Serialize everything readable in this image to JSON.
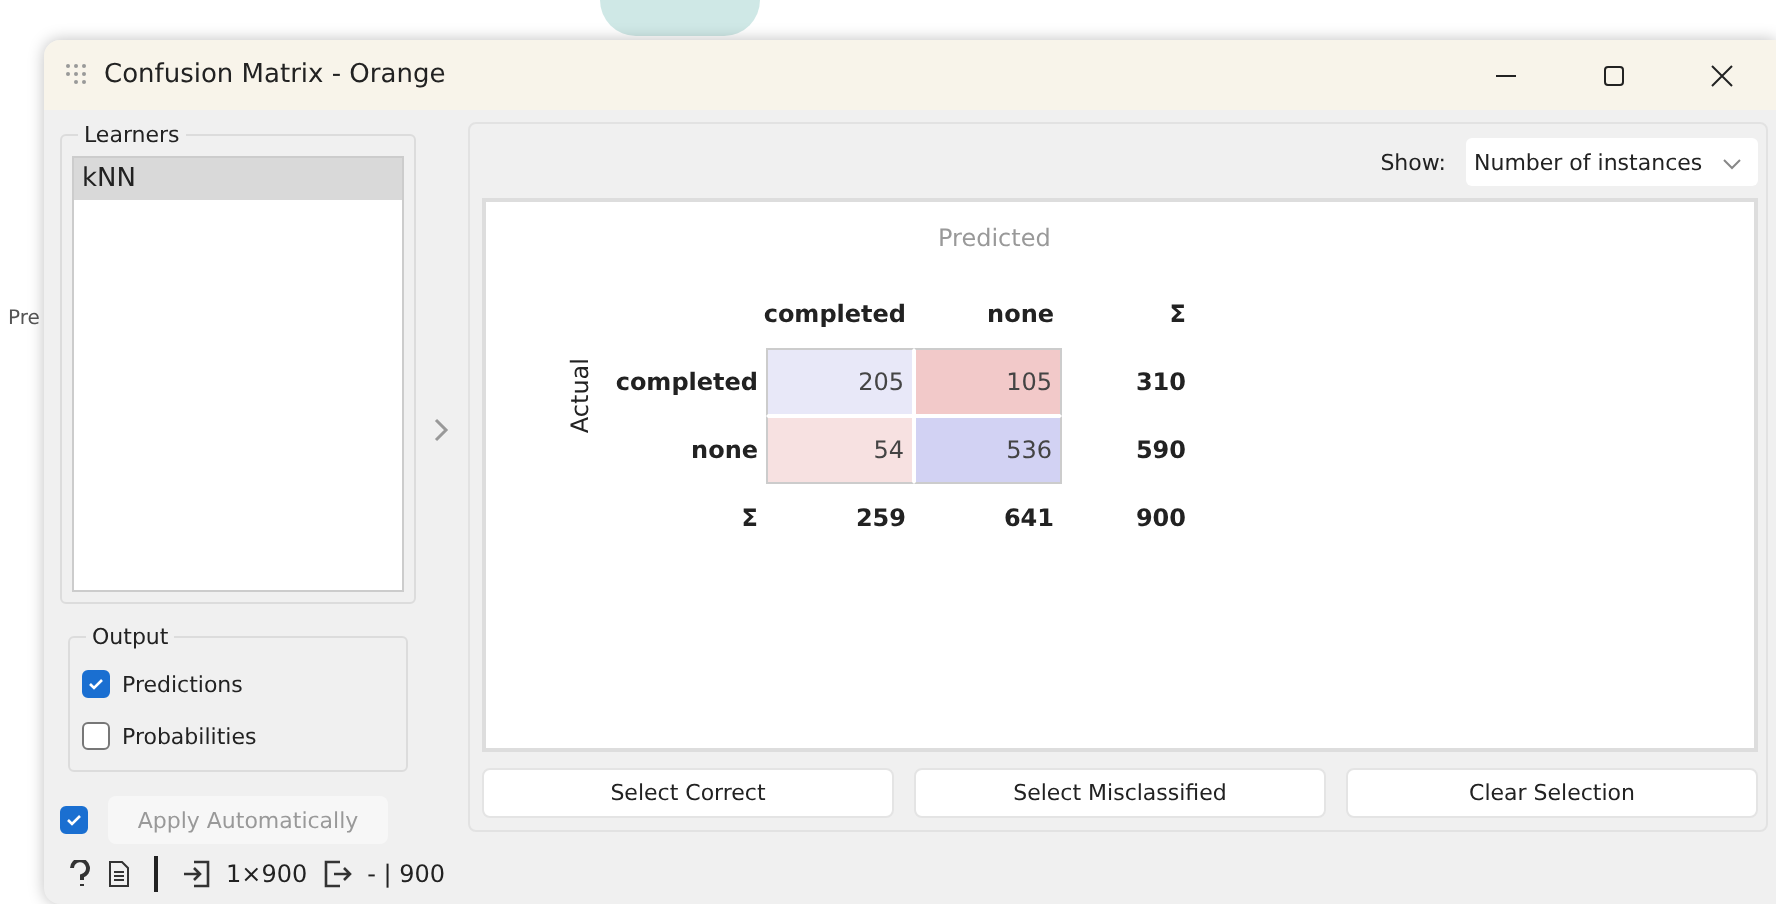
{
  "canvas": {
    "fragments": [
      "Pre"
    ]
  },
  "window": {
    "title": "Confusion Matrix - Orange"
  },
  "learners": {
    "title": "Learners",
    "items": [
      {
        "label": "kNN",
        "selected": true
      }
    ]
  },
  "output": {
    "title": "Output",
    "options": [
      {
        "label": "Predictions",
        "checked": true
      },
      {
        "label": "Probabilities",
        "checked": false
      }
    ]
  },
  "apply": {
    "label": "Apply Automatically",
    "checked": true,
    "disabled": true
  },
  "show": {
    "label": "Show:",
    "value": "Number of instances"
  },
  "matrix": {
    "predicted_label": "Predicted",
    "actual_label": "Actual",
    "columns": [
      "completed",
      "none",
      "Σ"
    ],
    "rows": [
      {
        "label": "completed",
        "cells": [
          {
            "value": "205",
            "color": "#e8e8f8"
          },
          {
            "value": "105",
            "color": "#f2c9c9"
          }
        ],
        "total": "310"
      },
      {
        "label": "none",
        "cells": [
          {
            "value": "54",
            "color": "#f7e1e1"
          },
          {
            "value": "536",
            "color": "#d2d2f3"
          }
        ],
        "total": "590"
      }
    ],
    "totals": {
      "label": "Σ",
      "values": [
        "259",
        "641",
        "900"
      ]
    }
  },
  "buttons": [
    "Select Correct",
    "Select Misclassified",
    "Clear Selection"
  ],
  "status_bar": {
    "input": "1×900",
    "output": "- | 900"
  }
}
